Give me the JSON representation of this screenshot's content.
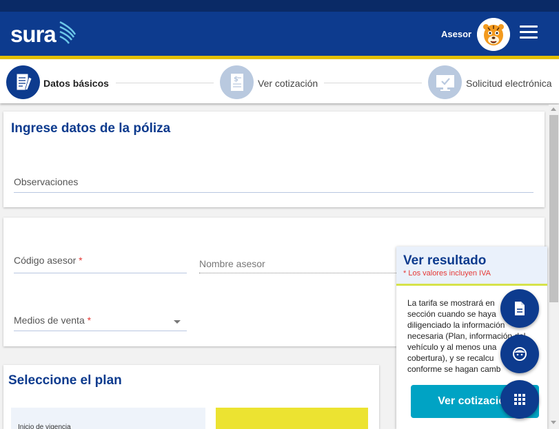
{
  "header": {
    "logo_text": "sura",
    "user_label": "Asesor",
    "menu_icon": "hamburger-icon"
  },
  "stepper": {
    "steps": [
      {
        "label": "Datos básicos",
        "icon": "document-pen-icon",
        "active": true
      },
      {
        "label": "Ver cotización",
        "icon": "invoice-icon",
        "active": false
      },
      {
        "label": "Solicitud electrónica",
        "icon": "monitor-check-icon",
        "active": false
      }
    ]
  },
  "policy_section": {
    "title": "Ingrese datos de la póliza",
    "observaciones_placeholder": "Observaciones"
  },
  "advisor_section": {
    "codigo_label": "Código asesor",
    "nombre_label": "Nombre asesor",
    "medios_label": "Medios de venta",
    "required_mark": "*"
  },
  "plan_section": {
    "title": "Seleccione el plan",
    "inicio_label": "Inicio de vigencia"
  },
  "result_panel": {
    "title": "Ver resultado",
    "note": "* Los valores incluyen IVA",
    "body_lines": [
      "La tarifa se mostrará en",
      "sección cuando se haya",
      "diligenciado la información",
      "necesaria (Plan, información del",
      "vehículo y al menos una",
      "cobertura), y se recalcu",
      "conforme se hagan camb"
    ],
    "button_label": "Ver cotización"
  },
  "fabs": [
    {
      "icon": "document-icon"
    },
    {
      "icon": "face-icon"
    },
    {
      "icon": "apps-grid-icon"
    }
  ],
  "colors": {
    "brand_blue": "#0d3b8e",
    "accent_yellow": "#e3c000",
    "button_cyan": "#00a3c4",
    "required_red": "#e53935"
  }
}
